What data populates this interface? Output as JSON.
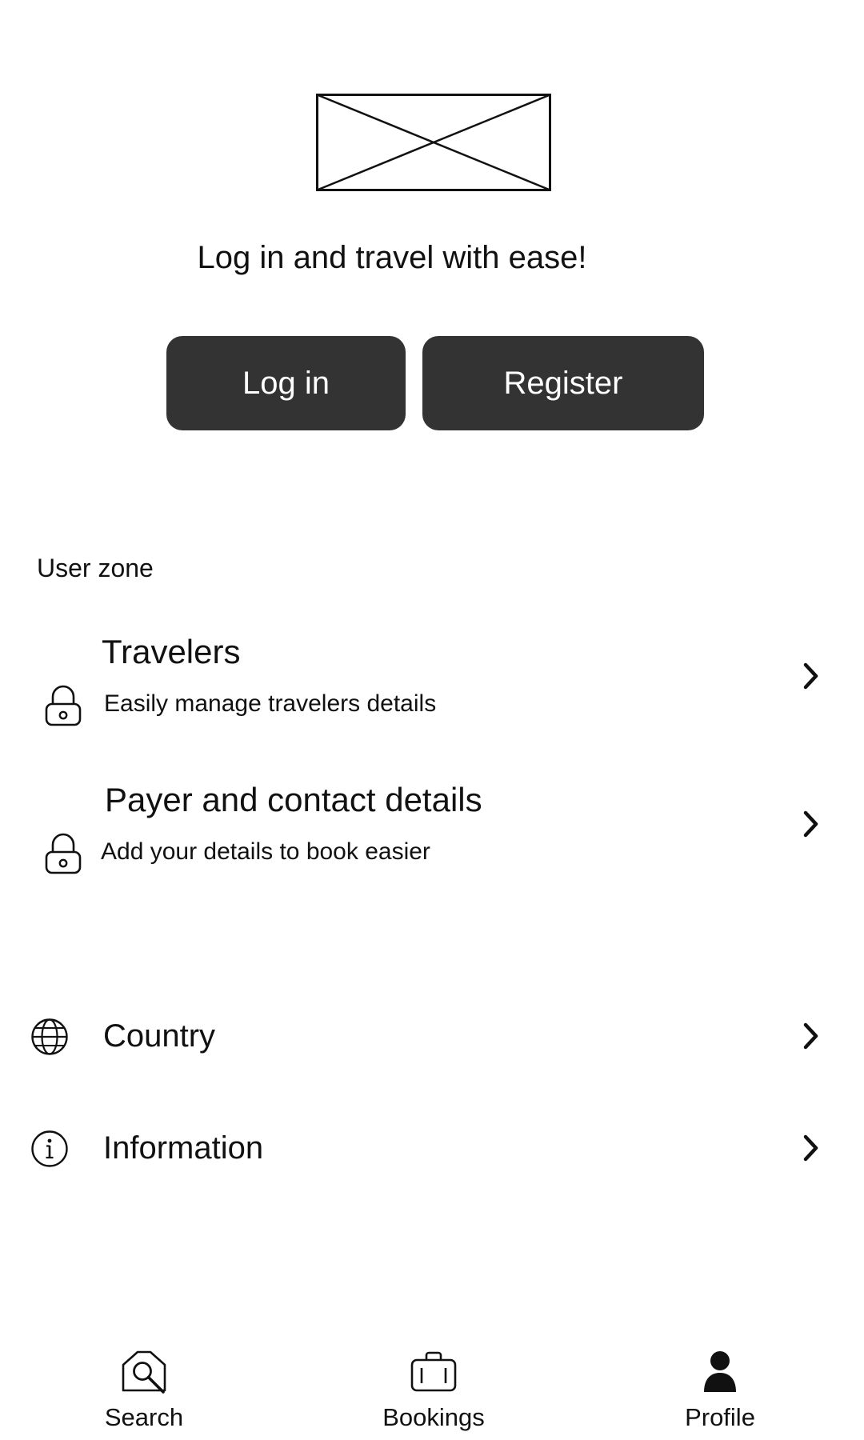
{
  "hero": {
    "logo_icon": "image-placeholder-icon",
    "tagline": "Log in and travel with ease!"
  },
  "auth": {
    "login_label": "Log in",
    "register_label": "Register"
  },
  "user_zone": {
    "section_label": "User zone",
    "items": [
      {
        "title": "Travelers",
        "subtitle": "Easily manage travelers details",
        "icon": "lock-icon"
      },
      {
        "title": "Payer and contact details",
        "subtitle": "Add your details to book easier",
        "icon": "lock-icon"
      }
    ]
  },
  "settings": {
    "items": [
      {
        "label": "Country",
        "icon": "globe-icon"
      },
      {
        "label": "Information",
        "icon": "info-icon"
      }
    ]
  },
  "bottom_nav": {
    "items": [
      {
        "label": "Search",
        "icon": "search-icon"
      },
      {
        "label": "Bookings",
        "icon": "briefcase-icon"
      },
      {
        "label": "Profile",
        "icon": "profile-icon"
      }
    ],
    "active": "Profile"
  },
  "colors": {
    "button_bg": "#333333",
    "button_text": "#ffffff",
    "text": "#111111",
    "background": "#ffffff"
  }
}
